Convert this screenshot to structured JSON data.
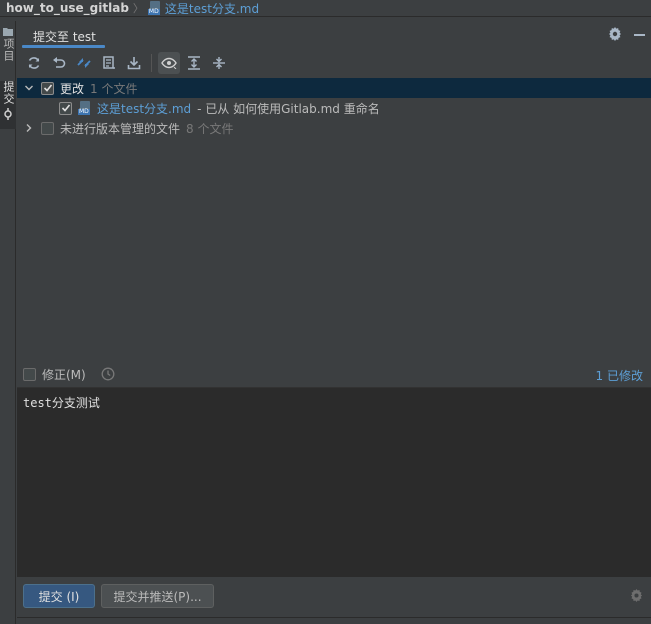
{
  "breadcrumb": {
    "project": "how_to_use_gitlab",
    "separator": "〉",
    "file": "这是test分支.md",
    "file_icon_tag": "MD"
  },
  "left_strip": {
    "project_tab": "项目",
    "commit_tab": "提交"
  },
  "panel": {
    "tab_label": "提交至 test"
  },
  "toolbar": {
    "icons": [
      "refresh-icon",
      "rollback-icon",
      "diff-icon",
      "shelve-icon",
      "download-icon",
      "eye-icon",
      "expand-all-icon",
      "collapse-all-icon"
    ]
  },
  "tree": {
    "changes": {
      "label": "更改",
      "count": "1 个文件"
    },
    "file": {
      "name": "这是test分支.md",
      "description": "- 已从 如何使用Gitlab.md 重命名"
    },
    "unversioned": {
      "label": "未进行版本管理的文件",
      "count": "8 个文件"
    }
  },
  "amend": {
    "label": "修正(M)",
    "modified": "1 已修改"
  },
  "editor": {
    "message": "test分支测试"
  },
  "buttons": {
    "commit": "提交 (I)",
    "commit_push": "提交并推送(P)..."
  },
  "colors": {
    "accent": "#4a88c7",
    "link": "#5d9fd6",
    "selection": "#0d293e",
    "background": "#3c3f41",
    "editor": "#2b2b2b"
  }
}
